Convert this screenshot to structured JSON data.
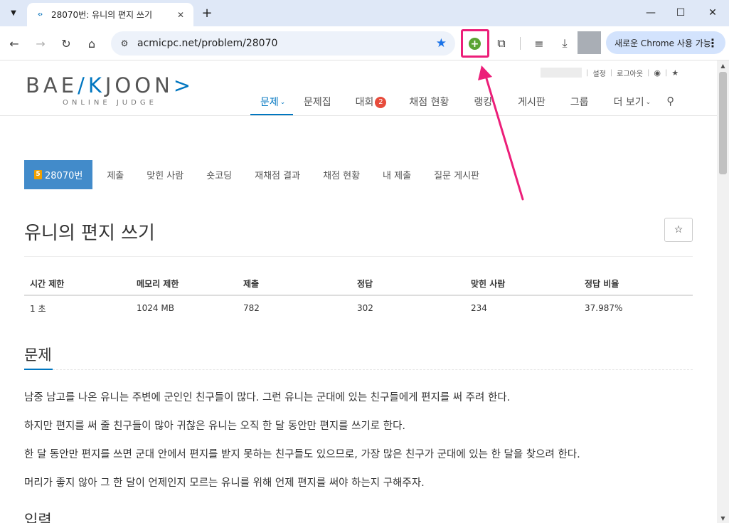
{
  "browser": {
    "tab_title": "28070번: 유니의 편지 쓰기",
    "url": "acmicpc.net/problem/28070",
    "chrome_promo": "새로운 Chrome 사용 가능",
    "accent_color": "#ec1e79"
  },
  "site": {
    "logo_main_left": "BAE",
    "logo_main_mark": "K",
    "logo_main_right": "JOON",
    "logo_sub": "ONLINE JUDGE",
    "topbar": {
      "settings": "설정",
      "logout": "로그아웃"
    },
    "nav": [
      {
        "label": "문제",
        "caret": true,
        "active": true
      },
      {
        "label": "문제집"
      },
      {
        "label": "대회",
        "badge": "2"
      },
      {
        "label": "채점 현황"
      },
      {
        "label": "랭킹"
      },
      {
        "label": "게시판"
      },
      {
        "label": "그룹"
      },
      {
        "label": "더 보기",
        "caret": true
      }
    ]
  },
  "problem": {
    "tier": "5",
    "id_tab": "28070번",
    "subtabs": [
      "제출",
      "맞힌 사람",
      "숏코딩",
      "재채점 결과",
      "채점 현황",
      "내 제출",
      "질문 게시판"
    ],
    "title": "유니의 편지 쓰기",
    "stats_headers": [
      "시간 제한",
      "메모리 제한",
      "제출",
      "정답",
      "맞힌 사람",
      "정답 비율"
    ],
    "stats_values": [
      "1 초",
      "1024 MB",
      "782",
      "302",
      "234",
      "37.987%"
    ],
    "section_title": "문제",
    "paragraphs": [
      "남중 남고를 나온 유니는 주변에 군인인 친구들이 많다. 그런 유니는 군대에 있는 친구들에게 편지를 써 주려 한다.",
      "하지만 편지를 써 줄 친구들이 많아 귀찮은 유니는 오직 한 달 동안만 편지를 쓰기로 한다.",
      "한 달 동안만 편지를 쓰면 군대 안에서 편지를 받지 못하는 친구들도 있으므로, 가장 많은 친구가 군대에 있는 한 달을 찾으려 한다.",
      "머리가 좋지 않아 그 한 달이 언제인지 모르는 유니를 위해 언제 편지를 써야 하는지 구해주자."
    ],
    "section2_title": "입력"
  }
}
